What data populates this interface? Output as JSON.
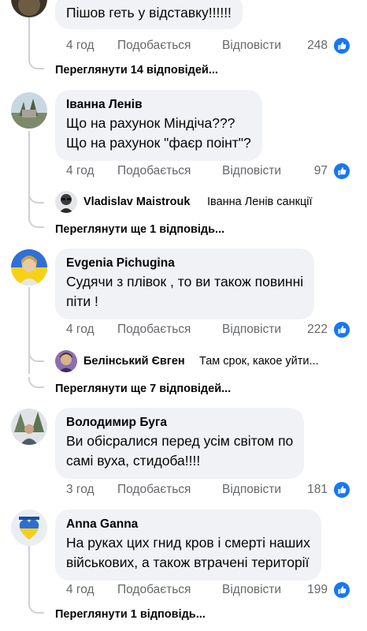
{
  "comments": [
    {
      "text": "Пішов геть у відставку!!!!!!",
      "time": "4 год",
      "like_label": "Подобається",
      "reply_label": "Відповісти",
      "likes": "248",
      "view_replies": "Переглянути 14 відповідей..."
    },
    {
      "author": "Іванна Ленів",
      "text_line1": "Що на рахунок Міндіча???",
      "text_line2": "Що на рахунок \"фаєр поінт\"?",
      "time": "4 год",
      "like_label": "Подобається",
      "reply_label": "Відповісти",
      "likes": "97",
      "reply_preview": {
        "author": "Vladislav Maistrouk",
        "text": "Іванна Ленів санкції"
      },
      "view_replies": "Переглянути ще 1 відповідь..."
    },
    {
      "author": "Evgenia  Pichugina",
      "text_line1": "Судячи з плівок , то ви також повинні",
      "text_line2": "піти !",
      "time": "4 год",
      "like_label": "Подобається",
      "reply_label": "Відповісти",
      "likes": "222",
      "reply_preview": {
        "author": "Белінський Євген",
        "text": "Там срок, какое уйти..."
      },
      "view_replies": "Переглянути ще 7 відповідей..."
    },
    {
      "author": "Володимир Буга",
      "text_line1": "Ви обісралися перед усім світом по",
      "text_line2": "самі вуха, стидоба!!!!",
      "time": "3 год",
      "like_label": "Подобається",
      "reply_label": "Відповісти",
      "likes": "181"
    },
    {
      "author": "Anna Ganna",
      "text_line1": "На руках цих гнид кров і смерті наших",
      "text_line2": "військових, а також втрачені території",
      "time": "4 год",
      "like_label": "Подобається",
      "reply_label": "Відповісти",
      "likes": "199",
      "view_replies": "Переглянути 1 відповідь..."
    }
  ],
  "colors": {
    "like_blue": "#1877f2",
    "meta_gray": "#65676b",
    "bubble_bg": "#f0f2f5"
  }
}
